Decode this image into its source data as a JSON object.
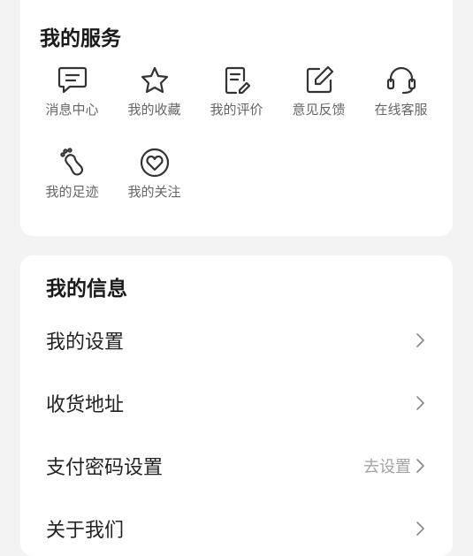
{
  "services": {
    "title": "我的服务",
    "items": [
      {
        "label": "消息中心",
        "icon": "message-icon"
      },
      {
        "label": "我的收藏",
        "icon": "star-icon"
      },
      {
        "label": "我的评价",
        "icon": "review-icon"
      },
      {
        "label": "意见反馈",
        "icon": "edit-icon"
      },
      {
        "label": "在线客服",
        "icon": "headset-icon"
      },
      {
        "label": "我的足迹",
        "icon": "footprint-icon"
      },
      {
        "label": "我的关注",
        "icon": "heart-circle-icon"
      }
    ]
  },
  "info": {
    "title": "我的信息",
    "rows": [
      {
        "label": "我的设置",
        "value": ""
      },
      {
        "label": "收货地址",
        "value": ""
      },
      {
        "label": "支付密码设置",
        "value": "去设置"
      },
      {
        "label": "关于我们",
        "value": ""
      }
    ]
  },
  "colors": {
    "background": "#f3f3f3",
    "card": "#ffffff",
    "icon": "#333333",
    "label": "#666666",
    "muted": "#a5a5a5"
  }
}
